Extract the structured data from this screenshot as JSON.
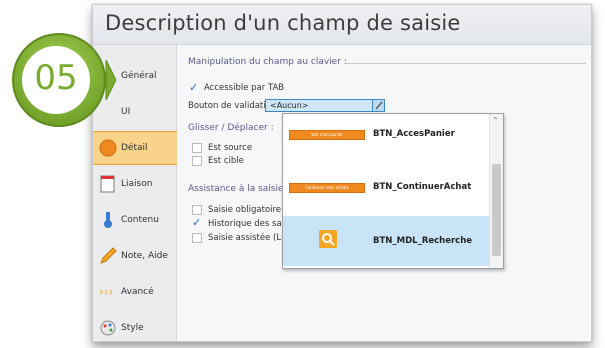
{
  "badge": {
    "number": "05",
    "colors": {
      "ring": "#8bbf3c",
      "fill": "#ffffff",
      "text": "#7aab2e"
    }
  },
  "window": {
    "title": "Description d'un champ de saisie"
  },
  "sidebar": {
    "items": [
      {
        "label": "Général",
        "icon": "settings-icon"
      },
      {
        "label": "UI",
        "icon": "ui-icon"
      },
      {
        "label": "Détail",
        "icon": "detail-icon",
        "active": true
      },
      {
        "label": "Liaison",
        "icon": "link-icon"
      },
      {
        "label": "Contenu",
        "icon": "content-icon"
      },
      {
        "label": "Note, Aide",
        "icon": "pencil-icon"
      },
      {
        "label": "Avancé",
        "icon": "advanced-icon"
      },
      {
        "label": "Style",
        "icon": "style-icon"
      }
    ]
  },
  "main": {
    "keyboard_section": "Manipulation du champ au clavier :",
    "accessible_tab": "Accessible par TAB",
    "validation_label": "Bouton de validation :",
    "validation_value": "<Aucun>",
    "drag_section": "Glisser / Déplacer :",
    "is_source": "Est source",
    "is_target": "Est cible",
    "assist_section": "Assistance à la saisie",
    "required": "Saisie obligatoire",
    "history": "Historique des sais",
    "assisted": "Saisie assistée (Lia"
  },
  "dropdown": {
    "items": [
      {
        "name": "BTN_AccesPanier",
        "thumb_text": "Voir mon panier"
      },
      {
        "name": "BTN_ContinuerAchat",
        "thumb_text": "Continuer mes achats"
      },
      {
        "name": "BTN_MDL_Recherche",
        "icon": "search-icon",
        "selected": true
      }
    ],
    "colors": {
      "button": "#f08a20",
      "selected": "#c8e4f6",
      "search": "#f5a623"
    }
  }
}
